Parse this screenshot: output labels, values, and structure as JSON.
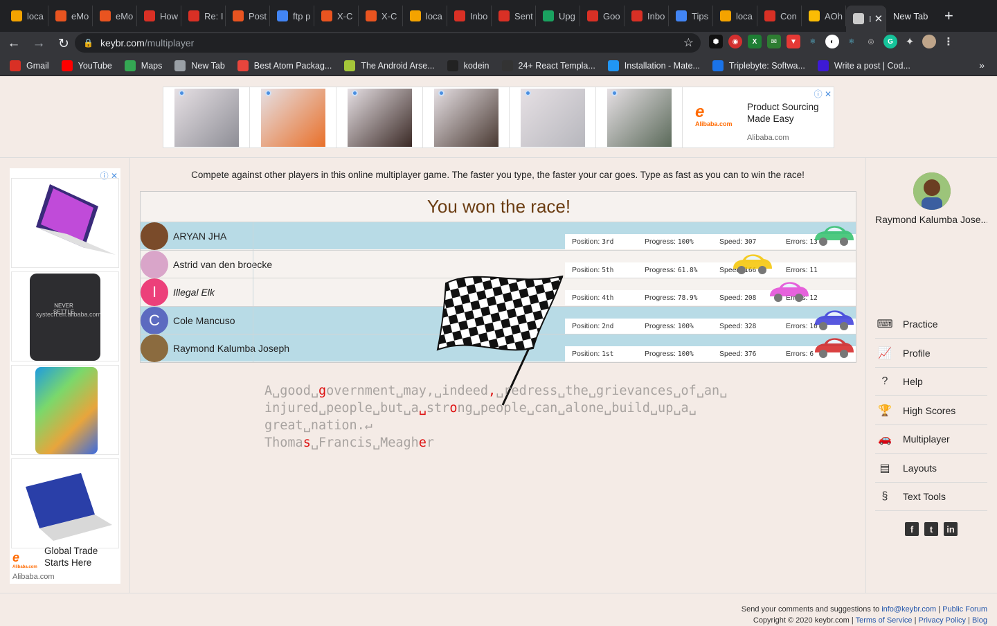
{
  "browser": {
    "tabs": [
      {
        "label": "loca",
        "icon": "ats-icon",
        "color": "#f4a300"
      },
      {
        "label": "eMo",
        "icon": "ubuntu-icon",
        "color": "#e95420"
      },
      {
        "label": "eMo",
        "icon": "ubuntu-icon",
        "color": "#e95420"
      },
      {
        "label": "How",
        "icon": "gmail-icon",
        "color": "#d93025"
      },
      {
        "label": "Re: I",
        "icon": "gmail-icon",
        "color": "#d93025"
      },
      {
        "label": "Post",
        "icon": "ubuntu-icon",
        "color": "#e95420"
      },
      {
        "label": "ftp p",
        "icon": "google-icon",
        "color": "#4285f4"
      },
      {
        "label": "X-C",
        "icon": "ubuntu-icon",
        "color": "#e95420"
      },
      {
        "label": "X-C",
        "icon": "ubuntu-icon",
        "color": "#e95420"
      },
      {
        "label": "loca",
        "icon": "ats-icon",
        "color": "#f4a300"
      },
      {
        "label": "Inbo",
        "icon": "gmail-icon",
        "color": "#d93025"
      },
      {
        "label": "Sent",
        "icon": "gmail-icon",
        "color": "#d93025"
      },
      {
        "label": "Upg",
        "icon": "mail-icon",
        "color": "#1aa260"
      },
      {
        "label": "Goo",
        "icon": "gmail-icon",
        "color": "#d93025"
      },
      {
        "label": "Inbo",
        "icon": "gmail-icon",
        "color": "#d93025"
      },
      {
        "label": "Tips",
        "icon": "google-icon",
        "color": "#4285f4"
      },
      {
        "label": "loca",
        "icon": "ats-icon",
        "color": "#f4a300"
      },
      {
        "label": "Con",
        "icon": "gmail-icon",
        "color": "#d93025"
      },
      {
        "label": "AOh",
        "icon": "photos-icon",
        "color": "#fbbc04"
      }
    ],
    "active_tab": {
      "label": "I"
    },
    "new_tab_label": "New Tab",
    "url_domain": "keybr.com",
    "url_path": "/multiplayer",
    "bookmarks": [
      {
        "label": "Gmail",
        "color": "#d93025"
      },
      {
        "label": "YouTube",
        "color": "#ff0000"
      },
      {
        "label": "Maps",
        "color": "#34a853"
      },
      {
        "label": "New Tab",
        "color": "#9aa0a6"
      },
      {
        "label": "Best Atom Packag...",
        "color": "#e8453c"
      },
      {
        "label": "The Android Arse...",
        "color": "#a4c639"
      },
      {
        "label": "kodein",
        "color": "#222222"
      },
      {
        "label": "24+ React Templa...",
        "color": "#333333"
      },
      {
        "label": "Installation - Mate...",
        "color": "#2196f3"
      },
      {
        "label": "Triplebyte: Softwa...",
        "color": "#1a73e8"
      },
      {
        "label": "Write a post | Cod...",
        "color": "#3d1ad6"
      }
    ]
  },
  "top_ad": {
    "headline": "Product Sourcing Made Easy",
    "domain": "Alibaba.com",
    "logo": "Alibaba.com",
    "logo_symbol": "e",
    "cells": 6
  },
  "left_ad": {
    "headline": "Global Trade Starts Here",
    "domain": "Alibaba.com",
    "logo": "e",
    "logo_small": "Alibaba.com",
    "phone_text": "NEVER SETTLE",
    "watermark": "xystech.en.alibaba.com"
  },
  "game": {
    "intro": "Compete against other players in this online multiplayer game. The faster you type, the faster your car goes. Type as fast as you can to win the race!",
    "result": "You won the race!",
    "labels": {
      "position": "Position:",
      "progress": "Progress:",
      "speed": "Speed:",
      "errors": "Errors:"
    },
    "players": [
      {
        "name": "ARYAN JHA",
        "position": "3rd",
        "progress": "100%",
        "progress_frac": 1.0,
        "speed": "307",
        "errors": "13",
        "car_color": "#2fbf6a",
        "avatar": "photo",
        "avatar_color": "#7a4b2a"
      },
      {
        "name": "Astrid van den broecke",
        "position": "5th",
        "progress": "61.8%",
        "progress_frac": 0.618,
        "speed": "166",
        "errors": "11",
        "car_color": "#f5c400",
        "avatar": "photo",
        "avatar_color": "#d9a5c9"
      },
      {
        "name": "Illegal Elk",
        "position": "4th",
        "progress": "78.9%",
        "progress_frac": 0.789,
        "speed": "208",
        "errors": "12",
        "car_color": "#e246d6",
        "avatar": "I",
        "avatar_color": "#ec407a"
      },
      {
        "name": "Cole Mancuso",
        "position": "2nd",
        "progress": "100%",
        "progress_frac": 1.0,
        "speed": "328",
        "errors": "10",
        "car_color": "#3b3bd9",
        "avatar": "C",
        "avatar_color": "#5c6bc0"
      },
      {
        "name": "Raymond Kalumba Joseph",
        "position": "1st",
        "progress": "100%",
        "progress_frac": 1.0,
        "speed": "376",
        "errors": "6",
        "car_color": "#d32020",
        "avatar": "photo",
        "avatar_color": "#8b6b3f"
      }
    ],
    "typing_lines": [
      [
        {
          "t": "A␣good␣"
        },
        {
          "t": "g",
          "err": true
        },
        {
          "t": "overnment␣may,␣indeed"
        },
        {
          "t": ",",
          "err": true
        },
        {
          "t": "␣redress␣the␣grievances␣of␣an␣"
        }
      ],
      [
        {
          "t": "injured␣people␣but␣a"
        },
        {
          "t": "␣",
          "err": true
        },
        {
          "t": "str"
        },
        {
          "t": "o",
          "err": true
        },
        {
          "t": "ng␣people␣can␣alone␣build␣up␣a␣"
        }
      ],
      [
        {
          "t": "great␣nation.↵"
        }
      ],
      [
        {
          "t": "Thoma"
        },
        {
          "t": "s",
          "err": true
        },
        {
          "t": "␣Francis␣Meagh"
        },
        {
          "t": "e",
          "err": true
        },
        {
          "t": "r"
        }
      ]
    ]
  },
  "sidebar": {
    "user": "Raymond Kalumba Jose...",
    "items": [
      {
        "label": "Practice",
        "icon": "keyboard-icon",
        "glyph": "⌨"
      },
      {
        "label": "Profile",
        "icon": "chart-icon",
        "glyph": "📈"
      },
      {
        "label": "Help",
        "icon": "help-icon",
        "glyph": "?"
      },
      {
        "label": "High Scores",
        "icon": "trophy-icon",
        "glyph": "🏆"
      },
      {
        "label": "Multiplayer",
        "icon": "car-icon",
        "glyph": "🚗"
      },
      {
        "label": "Layouts",
        "icon": "layouts-icon",
        "glyph": "▤"
      },
      {
        "label": "Text Tools",
        "icon": "section-icon",
        "glyph": "§"
      }
    ],
    "social": [
      {
        "name": "facebook-icon",
        "glyph": "f"
      },
      {
        "name": "twitter-icon",
        "glyph": "t"
      },
      {
        "name": "linkedin-icon",
        "glyph": "in"
      }
    ]
  },
  "footer": {
    "line1_text": "Send your comments and suggestions to",
    "email": "info@keybr.com",
    "forum": "Public Forum",
    "copyright": "Copyright © 2020 keybr.com",
    "terms": "Terms of Service",
    "privacy": "Privacy Policy",
    "blog": "Blog",
    "sep": "|"
  }
}
